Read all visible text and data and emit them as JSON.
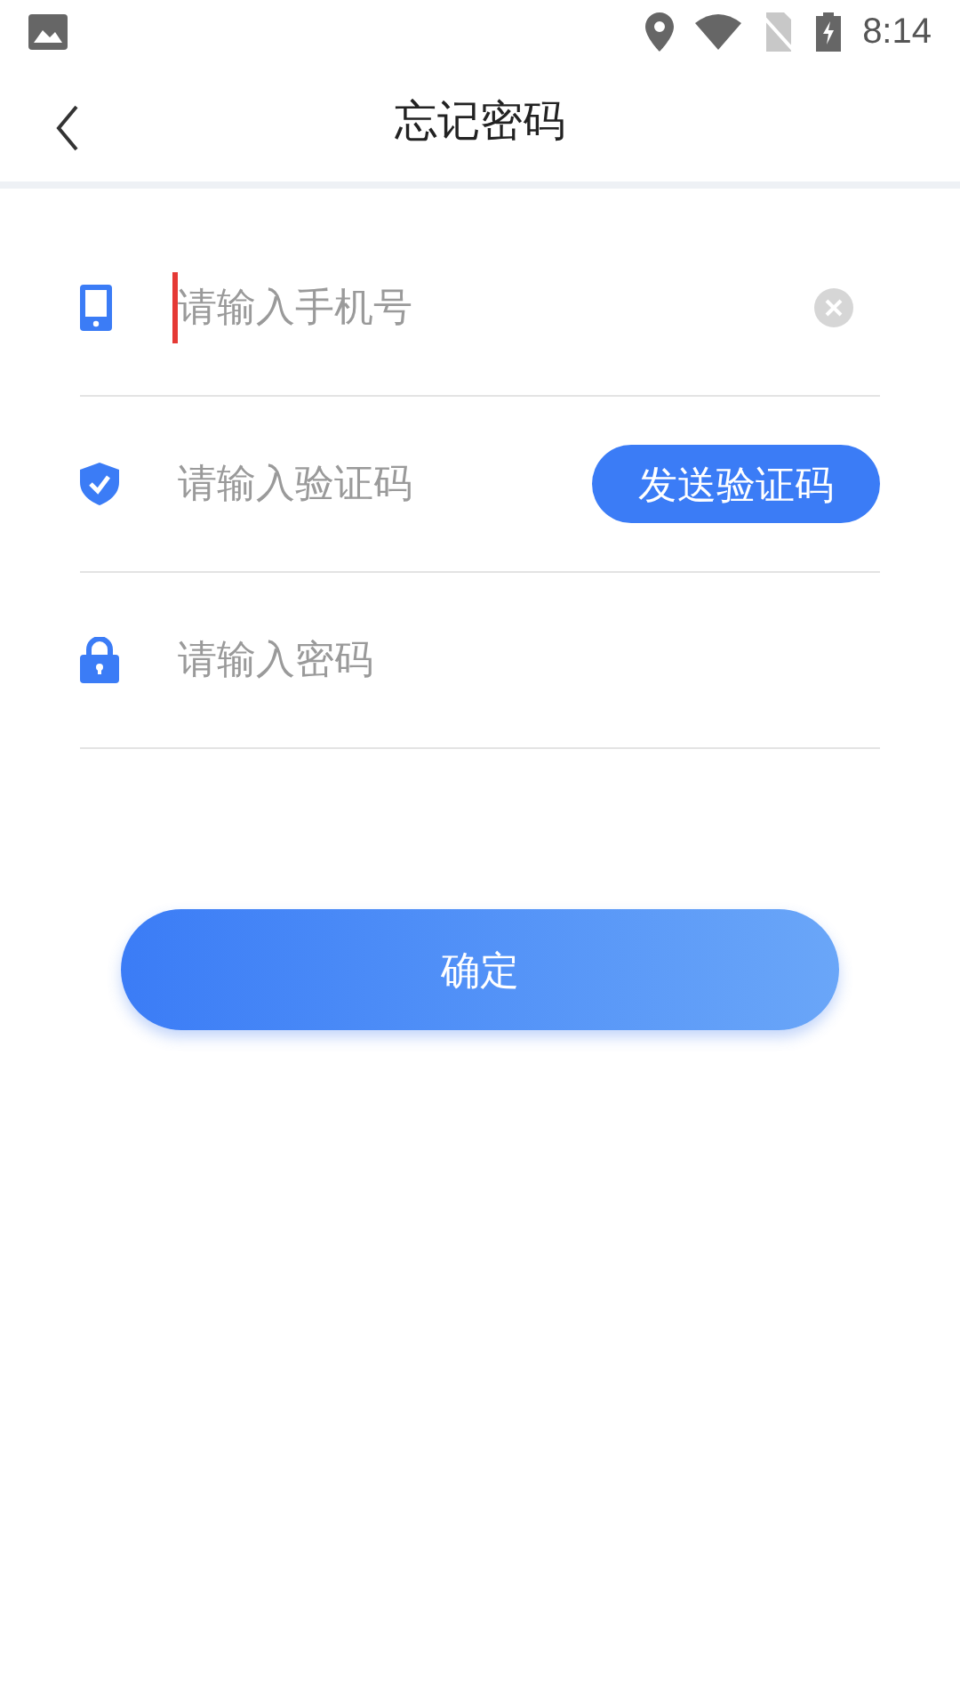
{
  "status_bar": {
    "time": "8:14"
  },
  "header": {
    "title": "忘记密码"
  },
  "fields": [
    {
      "kind": "phone",
      "placeholder": "请输入手机号",
      "focused": true
    },
    {
      "kind": "code",
      "placeholder": "请输入验证码",
      "focused": false,
      "button": "发送验证码"
    },
    {
      "kind": "password",
      "placeholder": "请输入密码",
      "focused": false
    }
  ],
  "submit": "确定"
}
